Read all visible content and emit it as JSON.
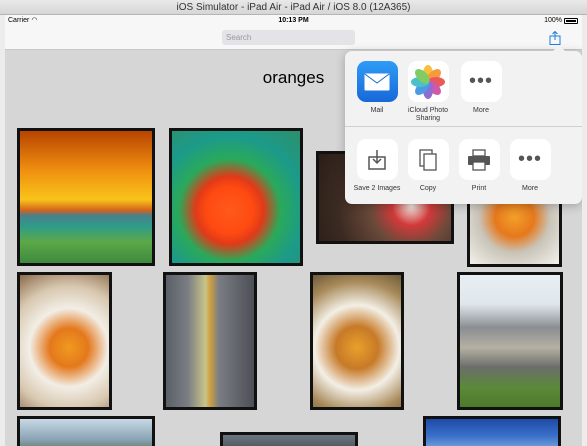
{
  "window": {
    "title": "iOS Simulator - iPad Air - iPad Air / iOS 8.0 (12A365)"
  },
  "status_bar": {
    "carrier": "Carrier",
    "time": "10:13 PM",
    "battery": "100%"
  },
  "nav_bar": {
    "search_placeholder": "Search"
  },
  "page": {
    "title": "oranges"
  },
  "share_sheet": {
    "share_row": [
      {
        "label": "Mail",
        "icon": "mail-icon"
      },
      {
        "label": "iCloud Photo Sharing",
        "icon": "photos-icon"
      },
      {
        "label": "More",
        "icon": "more-icon"
      }
    ],
    "action_row": [
      {
        "label": "Save 2 Images",
        "icon": "save-images-icon"
      },
      {
        "label": "Copy",
        "icon": "copy-icon"
      },
      {
        "label": "Print",
        "icon": "print-icon"
      },
      {
        "label": "More",
        "icon": "more-icon"
      }
    ]
  },
  "photos": [
    {
      "subject": "sunset-beach"
    },
    {
      "subject": "orange-lily"
    },
    {
      "subject": "bouquet-dark"
    },
    {
      "subject": "bride-bouquet-orange-roses"
    },
    {
      "subject": "bride-holding-bouquet"
    },
    {
      "subject": "groom-boutonniere"
    },
    {
      "subject": "bride-bouquet-sunflowers"
    },
    {
      "subject": "street-houses"
    },
    {
      "subject": "tree-sky"
    },
    {
      "subject": "blue-sky"
    },
    {
      "subject": "dark-photo"
    }
  ]
}
